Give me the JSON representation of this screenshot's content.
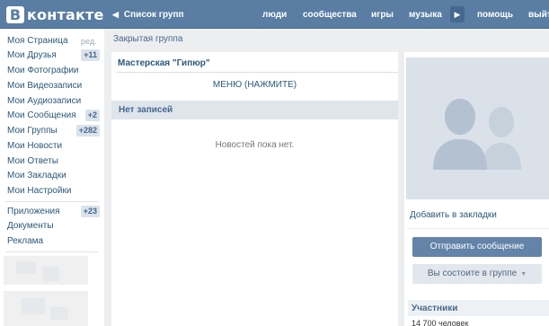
{
  "header": {
    "logo_letter": "В",
    "logo_text": "контакте",
    "back_label": "Список групп",
    "nav": [
      "люди",
      "сообщества",
      "игры",
      "музыка",
      "помощь",
      "выйти"
    ]
  },
  "leftmenu": {
    "items": [
      {
        "label": "Моя Страница",
        "edit": "ред."
      },
      {
        "label": "Мои Друзья",
        "badge": "+11"
      },
      {
        "label": "Мои Фотографии"
      },
      {
        "label": "Мои Видеозаписи"
      },
      {
        "label": "Мои Аудиозаписи"
      },
      {
        "label": "Мои Сообщения",
        "badge": "+2"
      },
      {
        "label": "Мои Группы",
        "badge": "+282"
      },
      {
        "label": "Мои Новости"
      },
      {
        "label": "Мои Ответы"
      },
      {
        "label": "Мои Закладки"
      },
      {
        "label": "Мои Настройки"
      }
    ],
    "extra": [
      {
        "label": "Приложения",
        "badge": "+23"
      },
      {
        "label": "Документы"
      },
      {
        "label": "Реклама"
      }
    ]
  },
  "group": {
    "type_label": "Закрытая группа",
    "name": "Мастерская \"Гипюр\"",
    "menu_link": "МЕНЮ (НАЖМИТЕ)",
    "wall_header": "Нет записей",
    "wall_empty": "Новостей пока нет."
  },
  "side": {
    "bookmark": "Добавить в закладки",
    "send_message": "Отправить сообщение",
    "member_status": "Вы состоите в группе",
    "members_header": "Участники",
    "members_count": "14 700 человек"
  },
  "colors": {
    "header": "#597da3",
    "link": "#2b587a",
    "bg": "#edeef0",
    "button": "#6383a8"
  },
  "icons": {
    "back": "chevron-left-icon",
    "play": "play-icon",
    "avatar": "group-placeholder-icon",
    "caret": "caret-down-icon"
  }
}
